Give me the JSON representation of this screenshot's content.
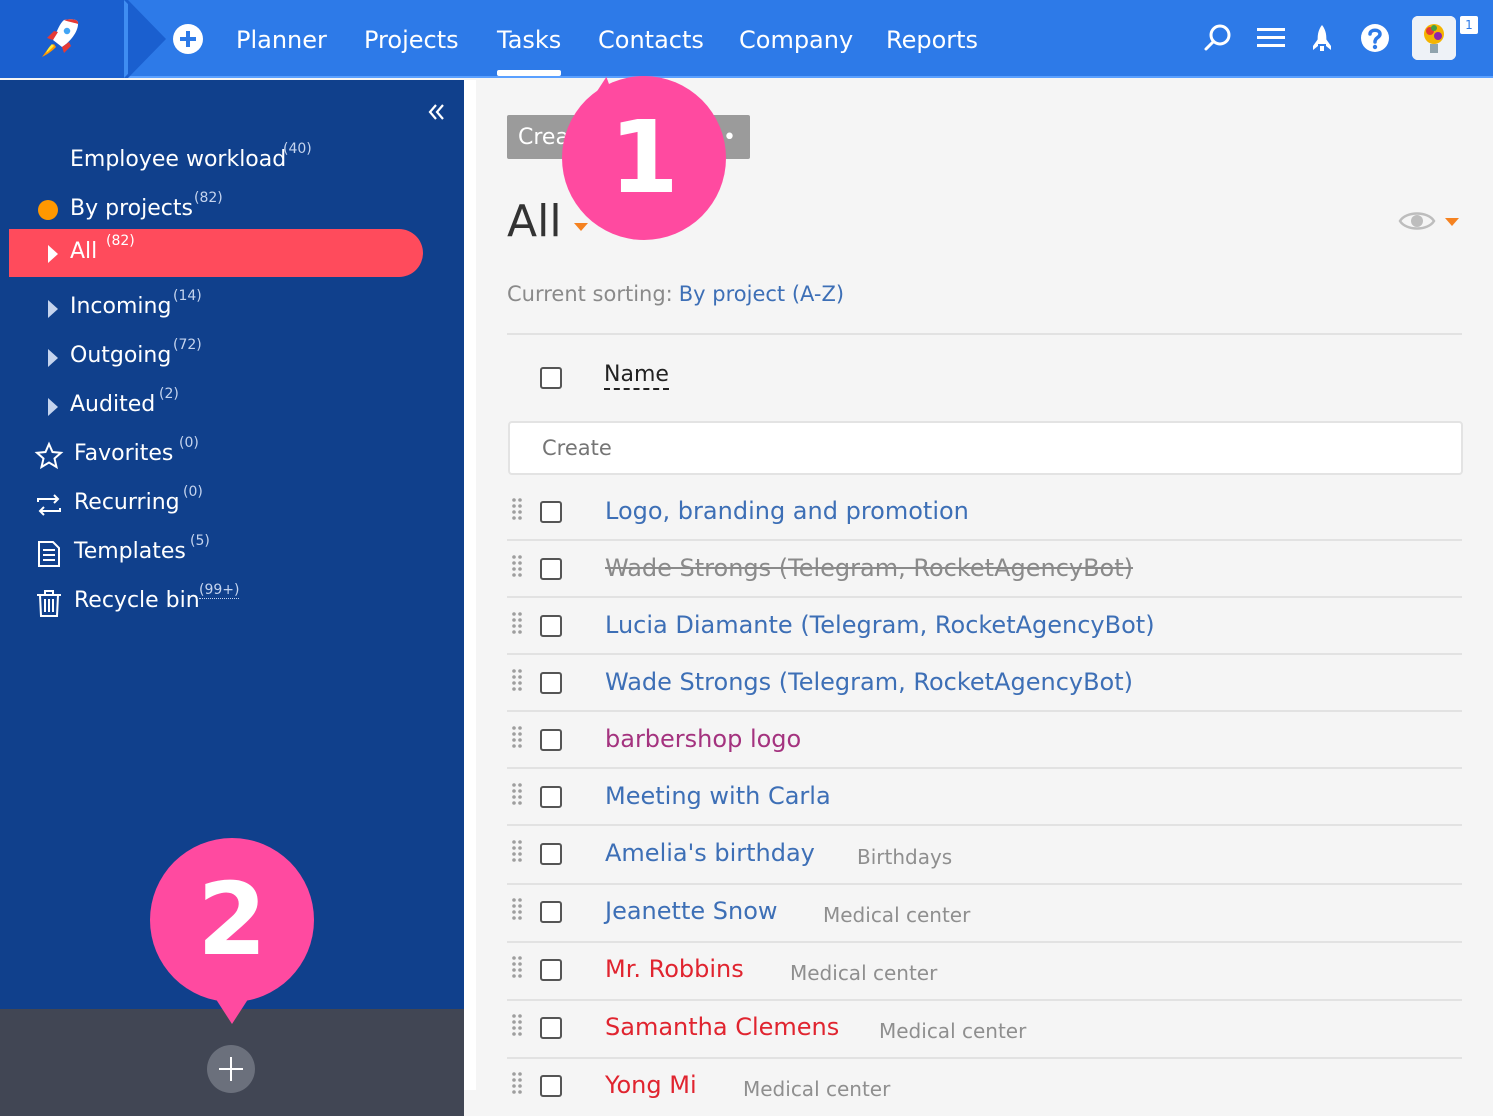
{
  "header": {
    "nav": [
      "Planner",
      "Projects",
      "Tasks",
      "Contacts",
      "Company",
      "Reports"
    ],
    "active_nav": "Tasks",
    "notification_count": "1",
    "accent": "#2d7ae8"
  },
  "sidebar": {
    "items": [
      {
        "label": "Employee workload",
        "count": "(40)"
      },
      {
        "label": "By projects",
        "count": "(82)"
      },
      {
        "label": "All",
        "count": "(82)"
      },
      {
        "label": "Incoming",
        "count": "(14)"
      },
      {
        "label": "Outgoing",
        "count": "(72)"
      },
      {
        "label": "Audited",
        "count": "(2)"
      },
      {
        "label": "Favorites",
        "count": "(0)"
      },
      {
        "label": "Recurring",
        "count": "(0)"
      },
      {
        "label": "Templates",
        "count": "(5)"
      },
      {
        "label": "Recycle bin",
        "count": "(99+)"
      }
    ],
    "bg": "#10408c",
    "active_color": "#ff4b5c"
  },
  "main": {
    "create_button": "Crea",
    "title": "All",
    "sorting_label": "Current sorting:",
    "sorting_value": "By project (A-Z)",
    "name_header": "Name",
    "create_placeholder": "Create",
    "tasks": [
      {
        "name": "Logo, branding and promotion",
        "project": ""
      },
      {
        "name": "Wade Strongs (Telegram, RocketAgencyBot)",
        "project": ""
      },
      {
        "name": "Lucia Diamante (Telegram, RocketAgencyBot)",
        "project": ""
      },
      {
        "name": "Wade Strongs (Telegram, RocketAgencyBot)",
        "project": ""
      },
      {
        "name": "barbershop logo",
        "project": ""
      },
      {
        "name": "Meeting with Carla",
        "project": ""
      },
      {
        "name": "Amelia's birthday",
        "project": "Birthdays"
      },
      {
        "name": "Jeanette Snow",
        "project": "Medical center"
      },
      {
        "name": "Mr. Robbins",
        "project": "Medical center"
      },
      {
        "name": "Samantha Clemens",
        "project": "Medical center"
      },
      {
        "name": "Yong Mi",
        "project": "Medical center"
      }
    ]
  },
  "callouts": {
    "one": "1",
    "two": "2",
    "color": "#ff4aa0"
  }
}
